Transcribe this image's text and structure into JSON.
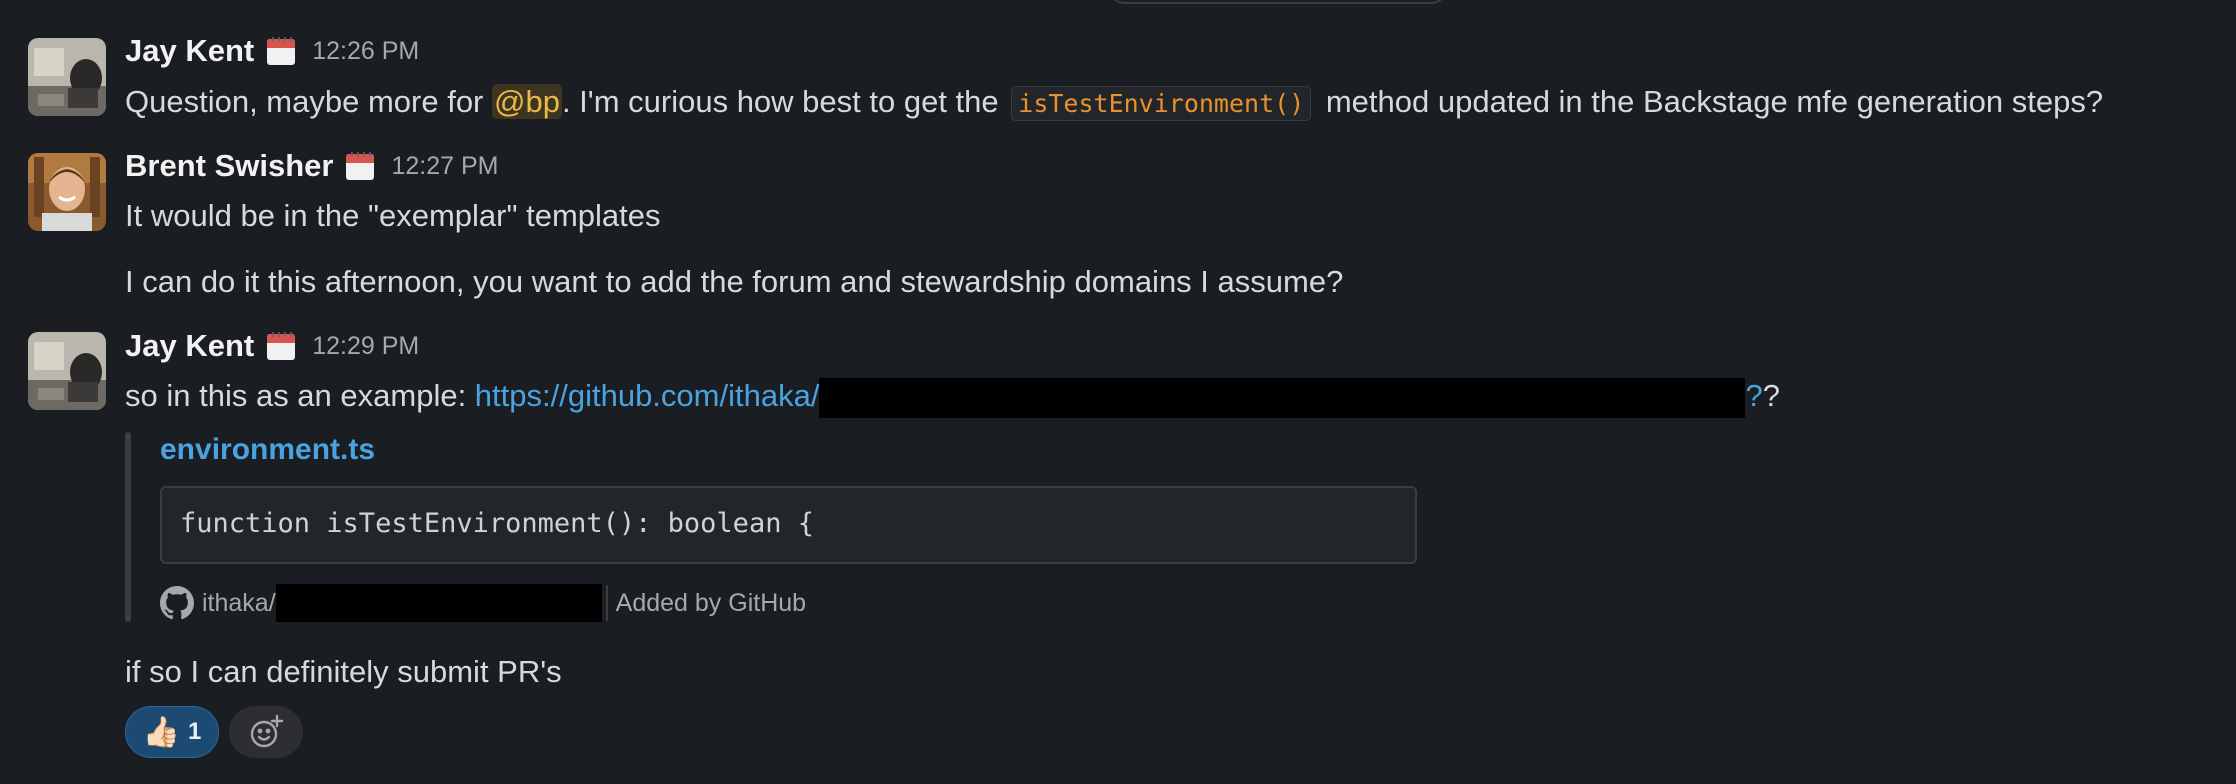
{
  "messages": [
    {
      "author": "Jay Kent",
      "time": "12:26 PM",
      "text": {
        "p1": "Question, maybe more for ",
        "mention": "@bp",
        "p2": ". I'm curious how best to get the ",
        "code": "isTestEnvironment()",
        "p3": " method updated in the Backstage mfe generation steps?"
      }
    },
    {
      "author": "Brent Swisher",
      "time": "12:27 PM",
      "line1": "It would be in the \"exemplar\" templates",
      "line2": "I can do it this afternoon, you want to add the forum and stewardship domains I assume?"
    },
    {
      "author": "Jay Kent",
      "time": "12:29 PM",
      "text": {
        "p1": "so in this as an example: ",
        "link": "https://github.com/ithaka/",
        "link_end": "?",
        "p2": "?"
      },
      "attachment": {
        "title": "environment.ts",
        "code": "function isTestEnvironment(): boolean {",
        "repo": "ithaka/",
        "added_by": "Added by GitHub"
      },
      "followup": "if so I can definitely submit PR's",
      "reactions": [
        {
          "emoji": "👍🏻",
          "count": "1"
        }
      ]
    }
  ],
  "icons": {
    "calendar": "calendar-icon",
    "github": "github-icon",
    "add_reaction": "add-reaction-icon"
  },
  "colors": {
    "background": "#1a1d21",
    "link": "#4aa3e0",
    "mention": "#e8b94a",
    "inline_code": "#e8912d",
    "reaction_active": "#1d4a73"
  }
}
